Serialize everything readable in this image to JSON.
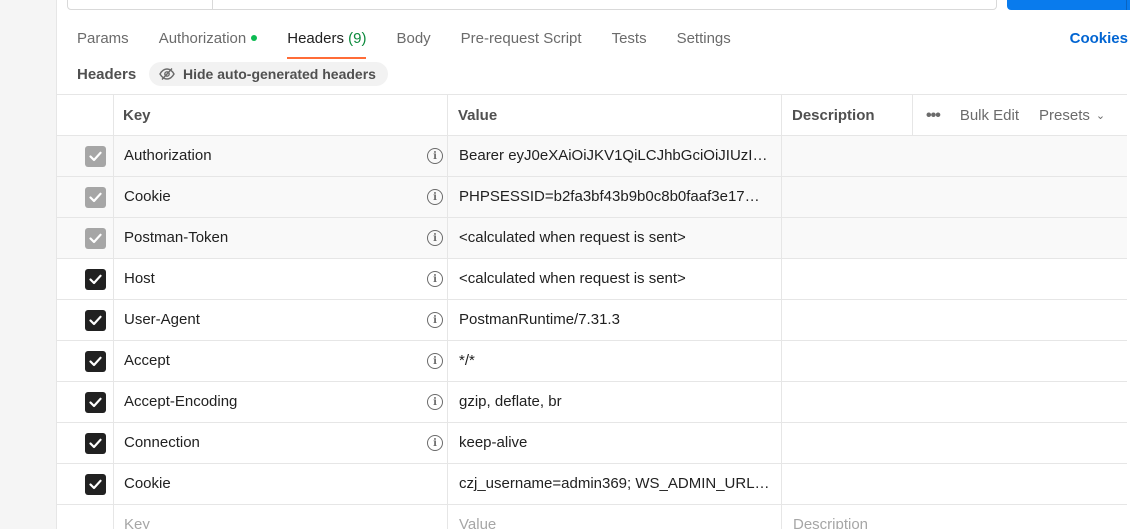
{
  "tabs": [
    {
      "label": "Params"
    },
    {
      "label": "Authorization",
      "has_dot": true
    },
    {
      "label": "Headers",
      "count": "(9)",
      "active": true
    },
    {
      "label": "Body"
    },
    {
      "label": "Pre-request Script"
    },
    {
      "label": "Tests"
    },
    {
      "label": "Settings"
    }
  ],
  "cookies_link": "Cookies",
  "headers_section": {
    "label": "Headers",
    "hide_button": "Hide auto-generated headers"
  },
  "table": {
    "columns": {
      "key": "Key",
      "value": "Value",
      "description": "Description"
    },
    "actions": {
      "more": "•••",
      "bulk_edit": "Bulk Edit",
      "presets": "Presets"
    },
    "rows": [
      {
        "key": "Authorization",
        "value": "Bearer eyJ0eXAiOiJKV1QiLCJhbGciOiJIUzI…",
        "checked": true,
        "auto": true,
        "info": true
      },
      {
        "key": "Cookie",
        "value": "PHPSESSID=b2fa3bf43b9b0c8b0faaf3e17…",
        "checked": true,
        "auto": true,
        "info": true
      },
      {
        "key": "Postman-Token",
        "value": "<calculated when request is sent>",
        "checked": true,
        "auto": true,
        "info": true
      },
      {
        "key": "Host",
        "value": "<calculated when request is sent>",
        "checked": true,
        "auto": false,
        "info": true
      },
      {
        "key": "User-Agent",
        "value": "PostmanRuntime/7.31.3",
        "checked": true,
        "auto": false,
        "info": true
      },
      {
        "key": "Accept",
        "value": "*/*",
        "checked": true,
        "auto": false,
        "info": true
      },
      {
        "key": "Accept-Encoding",
        "value": "gzip, deflate, br",
        "checked": true,
        "auto": false,
        "info": true
      },
      {
        "key": "Connection",
        "value": "keep-alive",
        "checked": true,
        "auto": false,
        "info": true
      },
      {
        "key": "Cookie",
        "value": "czj_username=admin369; WS_ADMIN_URL…",
        "checked": true,
        "auto": false,
        "info": false
      }
    ],
    "placeholder": {
      "key": "Key",
      "value": "Value",
      "description": "Description"
    }
  },
  "colors": {
    "accent_tab": "#ff6c37",
    "link": "#0265d2",
    "send_button": "#097bed",
    "status_dot": "#0cbb52"
  }
}
